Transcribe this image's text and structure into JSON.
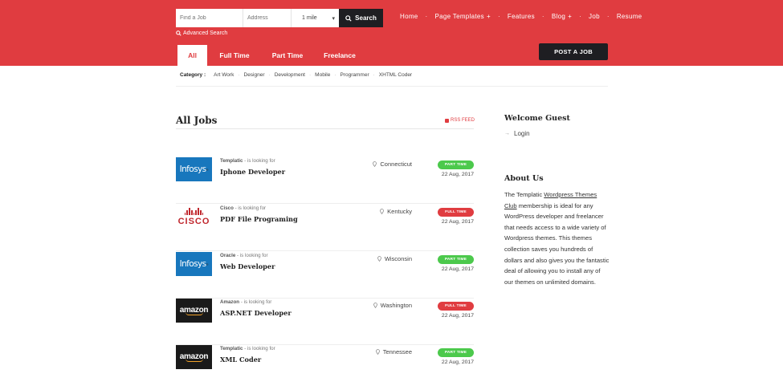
{
  "search": {
    "job_placeholder": "Find a Job",
    "address_placeholder": "Address",
    "radius_value": "1 mile",
    "button_label": "Search",
    "advanced_label": "Advanced Search"
  },
  "nav": {
    "home": "Home",
    "page_templates": "Page Templates",
    "features": "Features",
    "blog": "Blog",
    "job": "Job",
    "resume": "Resume",
    "separator": "·",
    "expand_mark": "+"
  },
  "tabs": {
    "all": "All",
    "full_time": "Full Time",
    "part_time": "Part Time",
    "freelance": "Freelance"
  },
  "post_job_label": "POST A JOB",
  "categories": {
    "label": "Category :",
    "separator": "·",
    "items": [
      "Art Work",
      "Designer",
      "Development",
      "Mobile",
      "Programmer",
      "XHTML Coder"
    ]
  },
  "jobs": {
    "title": "All Jobs",
    "rss_label": "RSS FEED",
    "looking_for": "- is looking for",
    "items": [
      {
        "company": "Templatic",
        "logo_text": "Infosys",
        "title": "Iphone Developer",
        "location": "Connecticut",
        "type": "PART TIME",
        "date": "22 Aug, 2017"
      },
      {
        "company": "Cisco",
        "logo_text": "CISCO",
        "title": "PDF File Programing",
        "location": "Kentucky",
        "type": "FULL TIME",
        "date": "22 Aug, 2017"
      },
      {
        "company": "Oracle",
        "logo_text": "Infosys",
        "title": "Web Developer",
        "location": "Wisconsin",
        "type": "PART TIME",
        "date": "22 Aug, 2017"
      },
      {
        "company": "Amazon",
        "logo_text": "amazon",
        "title": "ASP.NET Developer",
        "location": "Washington",
        "type": "FULL TIME",
        "date": "22 Aug, 2017"
      },
      {
        "company": "Templatic",
        "logo_text": "amazon",
        "title": "XML Coder",
        "location": "Tennessee",
        "type": "PART TIME",
        "date": "22 Aug, 2017"
      }
    ]
  },
  "sidebar": {
    "welcome_title": "Welcome Guest",
    "login_arrow": "→",
    "login_label": "Login",
    "about_title": "About Us",
    "about_pre": "The Templatic ",
    "about_link": "Wordpress Themes Club",
    "about_post": " membership is ideal for any WordPress developer and freelancer that needs access to a wide variety of Wordpress themes. This themes collection saves you hundreds of dollars and also gives you the fantastic deal of allowing you to install any of our themes on unlimited domains."
  },
  "colors": {
    "brand_red": "#e03c40",
    "dark": "#1e1e22",
    "part_time_green": "#4cc94c",
    "full_time_red": "#e03c40"
  }
}
